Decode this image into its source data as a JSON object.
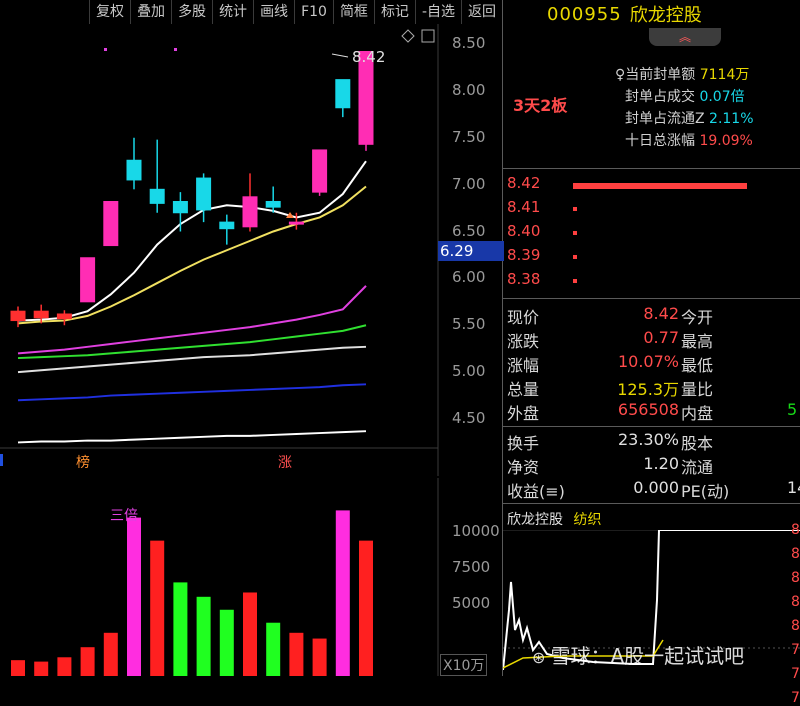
{
  "toolbar": {
    "buttons": [
      "复权",
      "叠加",
      "多股",
      "统计",
      "画线",
      "F10",
      "简框",
      "标记",
      "-自选",
      "返回"
    ]
  },
  "kchart": {
    "y_axis_labels": [
      "8.50",
      "8.00",
      "7.50",
      "7.00",
      "6.50",
      "6.00",
      "5.50",
      "5.00",
      "4.50"
    ],
    "current_price_tag": "6.29",
    "high_label": "8.42",
    "markers": [
      "榜",
      "涨"
    ],
    "colors": {
      "up": "#ff2db4",
      "down": "#18d8e8",
      "ma5": "#ffffff",
      "ma10": "#f0e060",
      "ma20": "#e040e0",
      "ma30": "#30e030",
      "ma60": "#e0e0e0",
      "ma120": "#2030e0",
      "ma250": "#ffffff",
      "price_tag_bg": "#1838a8"
    }
  },
  "volchart": {
    "y_axis_labels": [
      "10000",
      "7500",
      "5000"
    ],
    "unit_label": "X10万",
    "annotation": "三倍"
  },
  "chart_data": [
    {
      "type": "candlestick",
      "ylim": [
        4.2,
        8.6
      ],
      "candles": [
        {
          "open": 5.55,
          "close": 5.65,
          "high": 5.7,
          "low": 5.48,
          "dir": "up"
        },
        {
          "open": 5.58,
          "close": 5.65,
          "high": 5.72,
          "low": 5.52,
          "dir": "up"
        },
        {
          "open": 5.57,
          "close": 5.62,
          "high": 5.66,
          "low": 5.5,
          "dir": "up"
        },
        {
          "open": 5.75,
          "close": 6.22,
          "high": 6.22,
          "low": 5.75,
          "dir": "up"
        },
        {
          "open": 6.35,
          "close": 6.82,
          "high": 6.82,
          "low": 6.35,
          "dir": "up"
        },
        {
          "open": 7.26,
          "close": 7.05,
          "high": 7.5,
          "low": 6.95,
          "dir": "down"
        },
        {
          "open": 6.95,
          "close": 6.8,
          "high": 7.48,
          "low": 6.7,
          "dir": "down"
        },
        {
          "open": 6.82,
          "close": 6.7,
          "high": 6.92,
          "low": 6.5,
          "dir": "down"
        },
        {
          "open": 7.07,
          "close": 6.73,
          "high": 7.12,
          "low": 6.6,
          "dir": "down"
        },
        {
          "open": 6.6,
          "close": 6.53,
          "high": 6.68,
          "low": 6.36,
          "dir": "down"
        },
        {
          "open": 6.55,
          "close": 6.87,
          "high": 7.12,
          "low": 6.5,
          "dir": "up"
        },
        {
          "open": 6.82,
          "close": 6.76,
          "high": 6.98,
          "low": 6.7,
          "dir": "down"
        },
        {
          "open": 6.6,
          "close": 6.6,
          "high": 6.7,
          "low": 6.52,
          "dir": "up"
        },
        {
          "open": 6.92,
          "close": 7.37,
          "high": 7.37,
          "low": 6.88,
          "dir": "up"
        },
        {
          "open": 7.82,
          "close": 8.12,
          "high": 8.12,
          "low": 7.72,
          "dir": "down"
        },
        {
          "open": 7.43,
          "close": 8.42,
          "high": 8.42,
          "low": 7.36,
          "dir": "up"
        }
      ],
      "ma_lines": {
        "ma5": [
          5.55,
          5.56,
          5.58,
          5.65,
          5.83,
          6.06,
          6.36,
          6.58,
          6.73,
          6.78,
          6.76,
          6.72,
          6.65,
          6.7,
          6.9,
          7.25
        ],
        "ma10": [
          5.52,
          5.54,
          5.55,
          5.6,
          5.7,
          5.82,
          5.95,
          6.08,
          6.2,
          6.3,
          6.4,
          6.5,
          6.58,
          6.65,
          6.78,
          6.98
        ],
        "ma20": [
          5.2,
          5.22,
          5.24,
          5.27,
          5.3,
          5.33,
          5.36,
          5.39,
          5.42,
          5.45,
          5.48,
          5.52,
          5.56,
          5.61,
          5.67,
          5.92
        ],
        "ma30": [
          5.15,
          5.16,
          5.17,
          5.18,
          5.2,
          5.22,
          5.24,
          5.26,
          5.28,
          5.3,
          5.32,
          5.35,
          5.38,
          5.41,
          5.44,
          5.5
        ],
        "ma60": [
          5.0,
          5.02,
          5.04,
          5.06,
          5.08,
          5.1,
          5.12,
          5.14,
          5.16,
          5.17,
          5.18,
          5.2,
          5.22,
          5.24,
          5.26,
          5.27
        ],
        "ma120": [
          4.7,
          4.71,
          4.72,
          4.73,
          4.75,
          4.76,
          4.77,
          4.78,
          4.79,
          4.8,
          4.81,
          4.82,
          4.83,
          4.84,
          4.86,
          4.87
        ],
        "ma250": [
          4.25,
          4.26,
          4.26,
          4.27,
          4.27,
          4.28,
          4.29,
          4.3,
          4.31,
          4.32,
          4.32,
          4.33,
          4.34,
          4.35,
          4.36,
          4.37
        ]
      }
    },
    {
      "type": "bar",
      "ylim": [
        0,
        12000
      ],
      "values": [
        1100,
        1000,
        1300,
        2000,
        3000,
        11000,
        9400,
        6500,
        5500,
        4600,
        5800,
        3700,
        3000,
        2600,
        11500,
        9400
      ],
      "colors": [
        "red",
        "red",
        "red",
        "red",
        "red",
        "magenta",
        "red",
        "green",
        "green",
        "green",
        "red",
        "green",
        "red",
        "red",
        "magenta",
        "red"
      ]
    }
  ],
  "right": {
    "code": "000955",
    "name": "欣龙控股",
    "seal_tag": "3天2板",
    "seal": [
      {
        "label": "当前封单额",
        "value": "7114万",
        "color": "yellow"
      },
      {
        "label": "封单占成交",
        "value": "0.07倍",
        "color": "cyan"
      },
      {
        "label": "封单占流通Z",
        "value": "2.11%",
        "color": "cyan"
      },
      {
        "label": "十日总涨幅",
        "value": "19.09%",
        "color": "red"
      }
    ],
    "orders": [
      {
        "price": "8.42",
        "bar_fill": 1.0
      },
      {
        "price": "8.41",
        "bar_fill": 0.02
      },
      {
        "price": "8.40",
        "bar_fill": 0.02
      },
      {
        "price": "8.39",
        "bar_fill": 0.02
      },
      {
        "price": "8.38",
        "bar_fill": 0.02
      }
    ],
    "quotes": [
      {
        "l1": "现价",
        "v1": "8.42",
        "c1": "red",
        "l2": "今开",
        "v2": ""
      },
      {
        "l1": "涨跌",
        "v1": "0.77",
        "c1": "red",
        "l2": "最高",
        "v2": ""
      },
      {
        "l1": "涨幅",
        "v1": "10.07%",
        "c1": "red",
        "l2": "最低",
        "v2": ""
      },
      {
        "l1": "总量",
        "v1": "125.3万",
        "c1": "yellow",
        "l2": "量比",
        "v2": ""
      },
      {
        "l1": "外盘",
        "v1": "656508",
        "c1": "red",
        "l2": "内盘",
        "v2": "5"
      }
    ],
    "quotes2": [
      {
        "l1": "换手",
        "v1": "23.30%",
        "l2": "股本",
        "v2": ""
      },
      {
        "l1": "净资",
        "v1": "1.20",
        "l2": "流通",
        "v2": ""
      },
      {
        "l1": "收益(≡)",
        "v1": "0.000",
        "l2": "PE(动)",
        "v2": "14"
      }
    ],
    "mini": {
      "name": "欣龙控股",
      "sector": "纺织",
      "right_digits": [
        "8",
        "8",
        "8",
        "8",
        "8",
        "7",
        "7",
        "7"
      ]
    }
  },
  "watermark": "雪球：A股一起试试吧"
}
